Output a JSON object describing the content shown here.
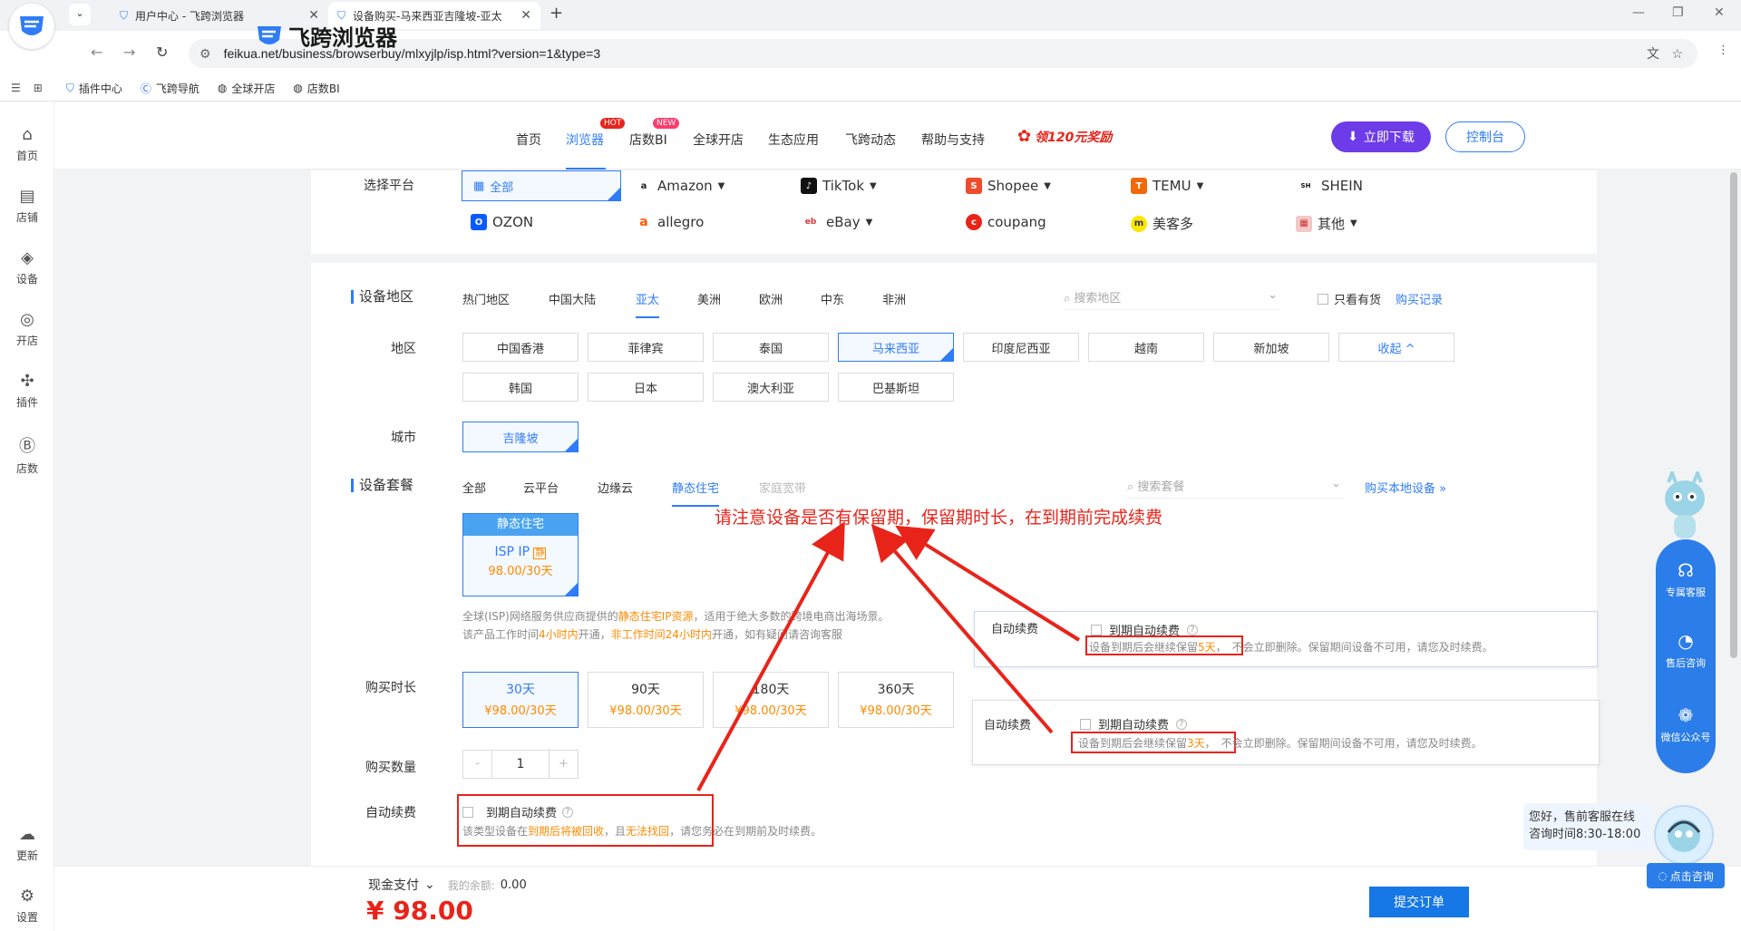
{
  "browser": {
    "tabs": [
      {
        "title": "用户中心 - 飞跨浏览器"
      },
      {
        "title": "设备购买-马来西亚吉隆坡-亚太"
      }
    ],
    "new_tab": "+",
    "url": "feikua.net/business/browserbuy/mlxyjlp/isp.html?version=1&type=3",
    "bookmarks": [
      "插件中心",
      "飞跨导航",
      "全球开店",
      "店数BI"
    ]
  },
  "sidebar": {
    "items": [
      {
        "label": "首页",
        "icon": "home-icon"
      },
      {
        "label": "店铺",
        "icon": "shop-icon"
      },
      {
        "label": "设备",
        "icon": "layers-icon"
      },
      {
        "label": "开店",
        "icon": "planet-icon"
      },
      {
        "label": "插件",
        "icon": "puzzle-icon"
      },
      {
        "label": "店数",
        "icon": "bi-icon"
      },
      {
        "label": "更新",
        "icon": "cloud-upload-icon"
      },
      {
        "label": "设置",
        "icon": "gear-icon"
      }
    ]
  },
  "header": {
    "logo_text": "飞跨浏览器",
    "nav": [
      "首页",
      "浏览器",
      "店数BI",
      "全球开店",
      "生态应用",
      "飞跨动态",
      "帮助与支持"
    ],
    "hot_badge": "HOT",
    "new_badge": "NEW",
    "promo": "领120元奖励",
    "download": "立即下载",
    "console": "控制台"
  },
  "platform": {
    "label": "选择平台",
    "row1": [
      "全部",
      "Amazon",
      "TikTok",
      "Shopee",
      "TEMU",
      "SHEIN"
    ],
    "row2": [
      "OZON",
      "allegro",
      "eBay",
      "coupang",
      "美客多",
      "其他"
    ]
  },
  "region": {
    "title": "设备地区",
    "tabs": [
      "热门地区",
      "中国大陆",
      "亚太",
      "美洲",
      "欧洲",
      "中东",
      "非洲"
    ],
    "search_placeholder": "搜索地区",
    "in_stock": "只看有货",
    "history": "购买记录",
    "area_label": "地区",
    "areas_row1": [
      "中国香港",
      "菲律宾",
      "泰国",
      "马来西亚",
      "印度尼西亚",
      "越南",
      "新加坡",
      "收起 ^"
    ],
    "areas_row2": [
      "韩国",
      "日本",
      "澳大利亚",
      "巴基斯坦"
    ],
    "city_label": "城市",
    "city": "吉隆坡"
  },
  "package": {
    "title": "设备套餐",
    "tabs": [
      "全部",
      "云平台",
      "边缘云",
      "静态住宅",
      "家庭宽带"
    ],
    "search_placeholder": "搜索套餐",
    "buy_local": "购买本地设备 »",
    "card_header": "静态住宅",
    "card_name": "ISP IP",
    "card_tag": "静",
    "card_price": "98.00/30天",
    "desc1_a": "全球(ISP)网络服务供应商提供的",
    "desc1_b": "静态住宅IP资源",
    "desc1_c": "，适用于绝大多数的跨境电商出海场景。",
    "desc2_a": "该产品工作时间",
    "desc2_b": "4小时内",
    "desc2_c": "开通，",
    "desc2_d": "非工作时间24小时内",
    "desc2_e": "开通，如有疑问请咨询客服"
  },
  "annotation": "请注意设备是否有保留期，保留期时长，在到期前完成续费",
  "duration": {
    "label": "购买时长",
    "options": [
      {
        "days": "30天",
        "price": "¥98.00/30天"
      },
      {
        "days": "90天",
        "price": "¥98.00/30天"
      },
      {
        "days": "180天",
        "price": "¥98.00/30天"
      },
      {
        "days": "360天",
        "price": "¥98.00/30天"
      }
    ]
  },
  "quantity": {
    "label": "购买数量",
    "minus": "-",
    "value": "1",
    "plus": "+"
  },
  "autorenew": {
    "label": "自动续费",
    "checkbox": "到期自动续费",
    "note_a": "该类型设备在",
    "note_b": "到期后将被回收",
    "note_c": "，且",
    "note_d": "无法找回",
    "note_e": "，请您务必在到期前及时续费。"
  },
  "popup1": {
    "label": "自动续费",
    "checkbox": "到期自动续费",
    "keep_a": "设备到期后会继续保留",
    "keep_b": "5天",
    "keep_c": "，",
    "rest": "不会立即删除。保留期间设备不可用，请您及时续费。"
  },
  "popup2": {
    "label": "自动续费",
    "checkbox": "到期自动续费",
    "keep_a": "设备到期后会继续保留",
    "keep_b": "3天",
    "keep_c": "，",
    "rest": "不会立即删除。保留期间设备不可用，请您及时续费。"
  },
  "footer": {
    "pay_method": "现金支付",
    "balance_label": "我的余额:",
    "balance": "0.00",
    "total": "¥ 98.00",
    "submit": "提交订单"
  },
  "service": {
    "items": [
      "专属客服",
      "售后咨询",
      "微信公众号"
    ],
    "tip1": "您好，售前客服在线",
    "tip2": "咨询时间8:30-18:00",
    "consult": "点击咨询"
  },
  "colors": {
    "accent": "#2f7cf6",
    "annotation": "#e8241a",
    "price": "#ff8a00",
    "download": "#6d3be8"
  }
}
